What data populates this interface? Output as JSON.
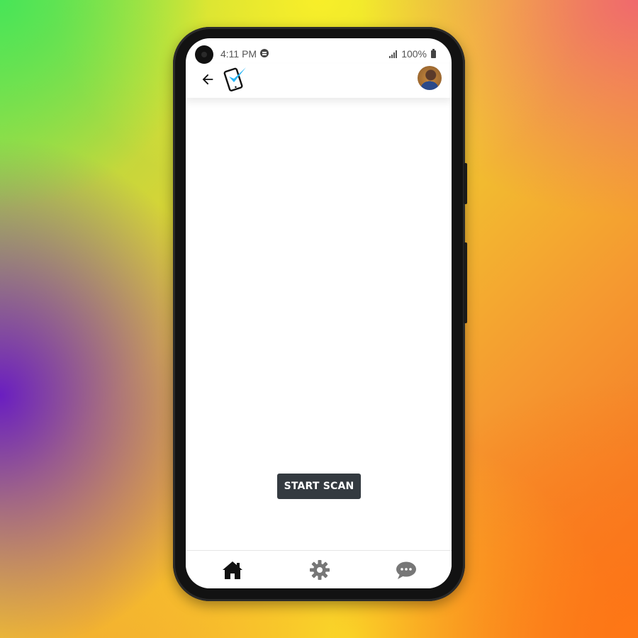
{
  "status_bar": {
    "time": "4:11 PM",
    "battery": "100%",
    "notification_icon": "spotify-icon",
    "signal_icon": "signal-icon",
    "battery_icon": "battery-icon"
  },
  "app_bar": {
    "back_icon": "arrow-left-icon",
    "logo_icon": "phone-check-logo",
    "avatar": "user-avatar",
    "logo_colors": {
      "phone": "#111111",
      "check": "#29b6f6"
    }
  },
  "main": {
    "start_scan_label": "START SCAN",
    "button_color": "#343a40"
  },
  "bottom_nav": {
    "items": [
      {
        "name": "home",
        "icon": "home-icon",
        "active": true,
        "color": "#111111"
      },
      {
        "name": "settings",
        "icon": "gear-icon",
        "active": false,
        "color": "#777777"
      },
      {
        "name": "chat",
        "icon": "chat-bubble-icon",
        "active": false,
        "color": "#777777"
      }
    ]
  }
}
